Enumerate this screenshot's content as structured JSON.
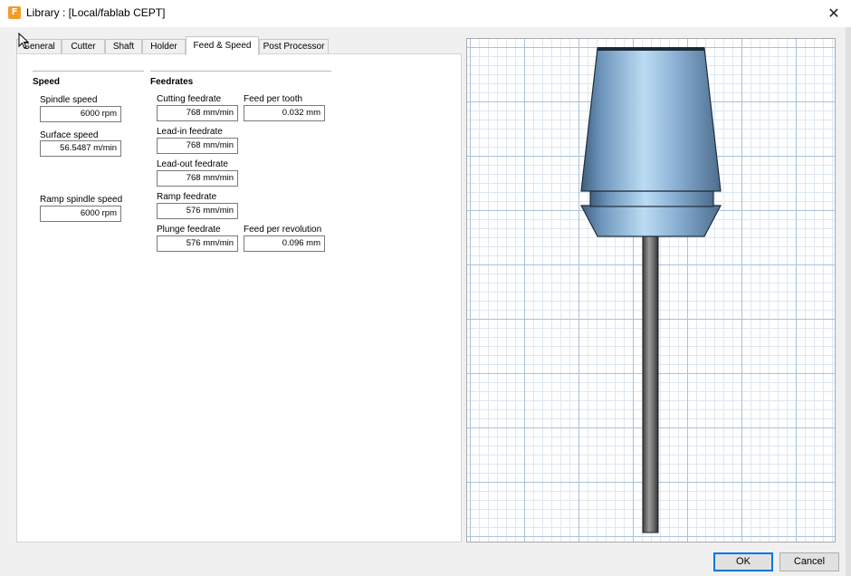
{
  "window": {
    "title": "Library : [Local/fablab CEPT]",
    "app_icon_letter": "F"
  },
  "tabs": [
    {
      "label": "General",
      "active": false
    },
    {
      "label": "Cutter",
      "active": false
    },
    {
      "label": "Shaft",
      "active": false
    },
    {
      "label": "Holder",
      "active": false
    },
    {
      "label": "Feed & Speed",
      "active": true
    },
    {
      "label": "Post Processor",
      "active": false
    }
  ],
  "speed": {
    "title": "Speed",
    "spindle_speed": {
      "label": "Spindle speed",
      "value": "6000 rpm"
    },
    "surface_speed": {
      "label": "Surface speed",
      "value": "56.5487 m/min"
    },
    "ramp_spindle_speed": {
      "label": "Ramp spindle speed",
      "value": "6000 rpm"
    }
  },
  "feedrates": {
    "title": "Feedrates",
    "cutting_feedrate": {
      "label": "Cutting feedrate",
      "value": "768 mm/min"
    },
    "feed_per_tooth": {
      "label": "Feed per tooth",
      "value": "0.032 mm"
    },
    "lead_in_feedrate": {
      "label": "Lead-in feedrate",
      "value": "768 mm/min"
    },
    "lead_out_feedrate": {
      "label": "Lead-out feedrate",
      "value": "768 mm/min"
    },
    "ramp_feedrate": {
      "label": "Ramp feedrate",
      "value": "576 mm/min"
    },
    "plunge_feedrate": {
      "label": "Plunge feedrate",
      "value": "576 mm/min"
    },
    "feed_per_revolution": {
      "label": "Feed per revolution",
      "value": "0.096 mm"
    }
  },
  "buttons": {
    "ok": "OK",
    "cancel": "Cancel"
  },
  "colors": {
    "holder_blue": "#7fa9cf",
    "shaft_gray": "#707070",
    "accent": "#0078d7"
  }
}
